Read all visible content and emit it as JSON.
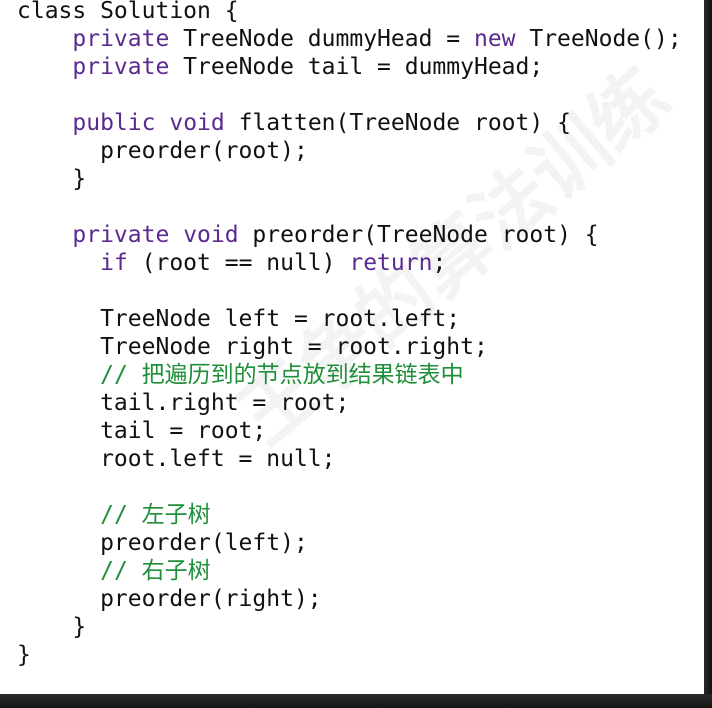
{
  "watermark": "王争的算法训练",
  "code_lines": [
    [
      {
        "t": "class Solution {",
        "c": "plain"
      }
    ],
    [
      {
        "t": "    ",
        "c": "plain"
      },
      {
        "t": "private",
        "c": "kw"
      },
      {
        "t": " TreeNode dummyHead = ",
        "c": "plain"
      },
      {
        "t": "new",
        "c": "kw"
      },
      {
        "t": " TreeNode();",
        "c": "plain"
      }
    ],
    [
      {
        "t": "    ",
        "c": "plain"
      },
      {
        "t": "private",
        "c": "kw"
      },
      {
        "t": " TreeNode tail = dummyHead;",
        "c": "plain"
      }
    ],
    [
      {
        "t": "",
        "c": "plain"
      }
    ],
    [
      {
        "t": "    ",
        "c": "plain"
      },
      {
        "t": "public",
        "c": "kw"
      },
      {
        "t": " ",
        "c": "plain"
      },
      {
        "t": "void",
        "c": "kw"
      },
      {
        "t": " flatten(TreeNode root) {",
        "c": "plain"
      }
    ],
    [
      {
        "t": "      preorder(root);",
        "c": "plain"
      }
    ],
    [
      {
        "t": "    }",
        "c": "plain"
      }
    ],
    [
      {
        "t": "",
        "c": "plain"
      }
    ],
    [
      {
        "t": "    ",
        "c": "plain"
      },
      {
        "t": "private",
        "c": "kw"
      },
      {
        "t": " ",
        "c": "plain"
      },
      {
        "t": "void",
        "c": "kw"
      },
      {
        "t": " preorder(TreeNode root) {",
        "c": "plain"
      }
    ],
    [
      {
        "t": "      ",
        "c": "plain"
      },
      {
        "t": "if",
        "c": "kw"
      },
      {
        "t": " (root == null) ",
        "c": "plain"
      },
      {
        "t": "return",
        "c": "kw"
      },
      {
        "t": ";",
        "c": "plain"
      }
    ],
    [
      {
        "t": "",
        "c": "plain"
      }
    ],
    [
      {
        "t": "      TreeNode left = root.left;",
        "c": "plain"
      }
    ],
    [
      {
        "t": "      TreeNode right = root.right;",
        "c": "plain"
      }
    ],
    [
      {
        "t": "      ",
        "c": "plain"
      },
      {
        "t": "// 把遍历到的节点放到结果链表中",
        "c": "cm"
      }
    ],
    [
      {
        "t": "      tail.right = root;",
        "c": "plain"
      }
    ],
    [
      {
        "t": "      tail = root;",
        "c": "plain"
      }
    ],
    [
      {
        "t": "      root.left = null;",
        "c": "plain"
      }
    ],
    [
      {
        "t": "",
        "c": "plain"
      }
    ],
    [
      {
        "t": "      ",
        "c": "plain"
      },
      {
        "t": "// 左子树",
        "c": "cm"
      }
    ],
    [
      {
        "t": "      preorder(left);",
        "c": "plain"
      }
    ],
    [
      {
        "t": "      ",
        "c": "plain"
      },
      {
        "t": "// 右子树",
        "c": "cm"
      }
    ],
    [
      {
        "t": "      preorder(right);",
        "c": "plain"
      }
    ],
    [
      {
        "t": "    }",
        "c": "plain"
      }
    ],
    [
      {
        "t": "}",
        "c": "plain"
      }
    ]
  ],
  "colors": {
    "keyword": "#5b2a8f",
    "comment": "#1f8f3a",
    "text": "#111111",
    "background": "#ffffff"
  }
}
